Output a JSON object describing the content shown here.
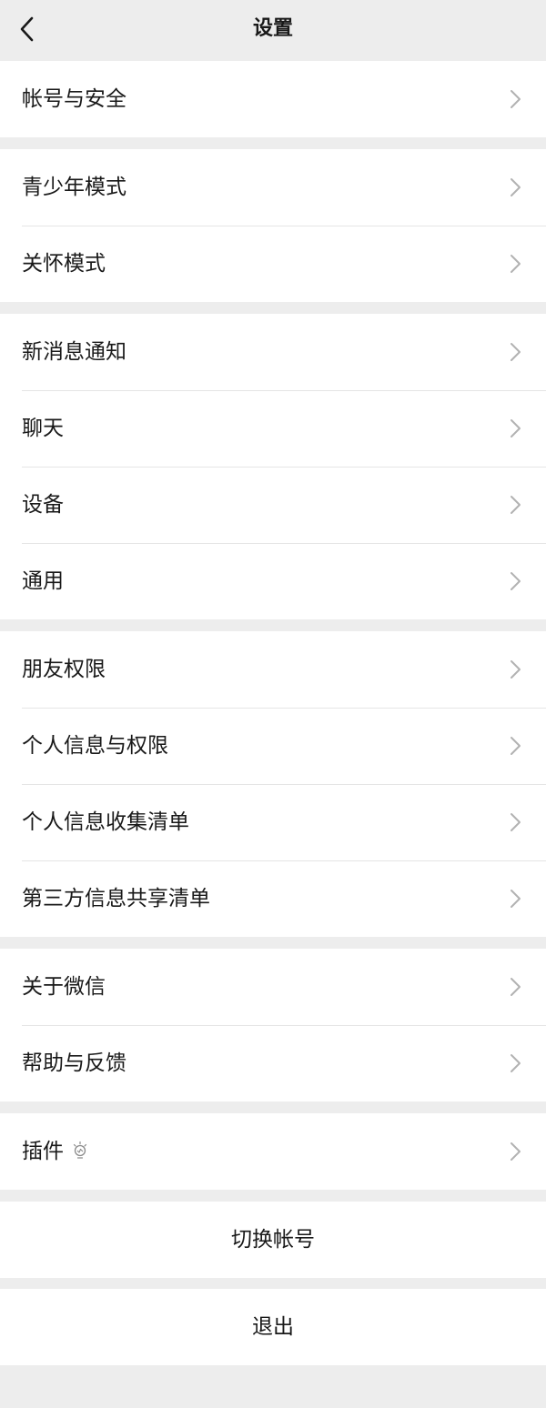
{
  "header": {
    "title": "设置",
    "back_icon": "chevron-left-icon"
  },
  "groups": [
    {
      "items": [
        {
          "label": "帐号与安全"
        }
      ]
    },
    {
      "items": [
        {
          "label": "青少年模式"
        },
        {
          "label": "关怀模式"
        }
      ]
    },
    {
      "items": [
        {
          "label": "新消息通知"
        },
        {
          "label": "聊天"
        },
        {
          "label": "设备"
        },
        {
          "label": "通用"
        }
      ]
    },
    {
      "items": [
        {
          "label": "朋友权限"
        },
        {
          "label": "个人信息与权限"
        },
        {
          "label": "个人信息收集清单"
        },
        {
          "label": "第三方信息共享清单"
        }
      ]
    },
    {
      "items": [
        {
          "label": "关于微信"
        },
        {
          "label": "帮助与反馈"
        }
      ]
    },
    {
      "items": [
        {
          "label": "插件",
          "icon": "lightbulb-icon"
        }
      ]
    }
  ],
  "actions": {
    "switch_account": "切换帐号",
    "logout": "退出"
  },
  "colors": {
    "page_background": "#ededed",
    "cell_background": "#ffffff",
    "text": "#191919",
    "separator": "#e5e5e5",
    "chevron": "#b2b2b2"
  }
}
